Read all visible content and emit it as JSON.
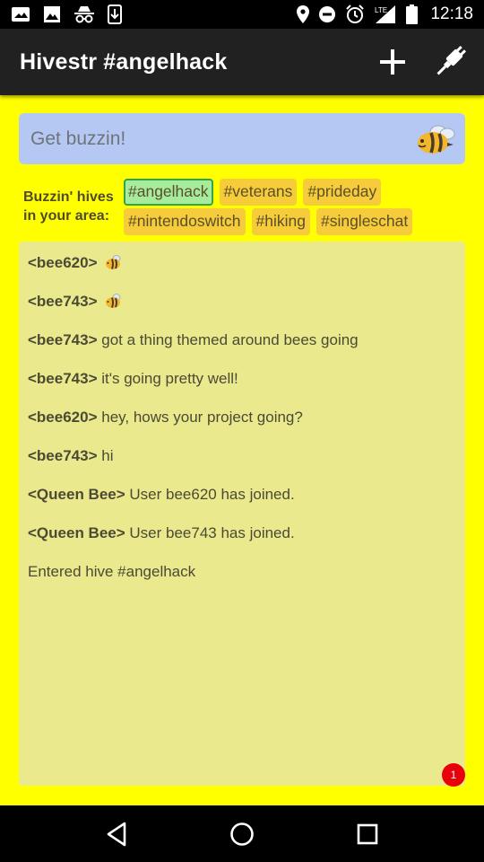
{
  "status_bar": {
    "time": "12:18",
    "icons": [
      "image-icon",
      "photo-icon",
      "incognito-icon",
      "download-icon",
      "location-icon",
      "do-not-disturb-icon",
      "alarm-icon",
      "lte-signal-icon",
      "battery-icon"
    ],
    "network_label": "LTE"
  },
  "app_bar": {
    "title": "Hivestr #angelhack",
    "actions": [
      "add-icon",
      "plug-icon"
    ]
  },
  "composer": {
    "placeholder": "Get buzzin!",
    "value": "",
    "icon": "bee-icon"
  },
  "hives": {
    "label_line1": "Buzzin' hives",
    "label_line2": "in your area:",
    "row1": [
      {
        "tag": "#angelhack",
        "active": true
      },
      {
        "tag": "#veterans",
        "active": false
      },
      {
        "tag": "#prideday",
        "active": false
      }
    ],
    "row2": [
      {
        "tag": "#nintendoswitch",
        "active": false
      },
      {
        "tag": "#hiking",
        "active": false
      },
      {
        "tag": "#singleschat",
        "active": false
      }
    ]
  },
  "messages": [
    {
      "user": "<bee620>",
      "text": "",
      "emoji": "bee-icon"
    },
    {
      "user": "<bee743>",
      "text": "",
      "emoji": "bee-icon"
    },
    {
      "user": "<bee743>",
      "text": " got a thing themed around bees going"
    },
    {
      "user": "<bee743>",
      "text": " it's going pretty well!"
    },
    {
      "user": "<bee620>",
      "text": " hey, hows your project going?"
    },
    {
      "user": "<bee743>",
      "text": " hi"
    },
    {
      "user": "<Queen Bee>",
      "text": " User bee620 has joined."
    },
    {
      "user": "<Queen Bee>",
      "text": " User bee743 has joined."
    },
    {
      "user": "",
      "text": "Entered hive #angelhack"
    }
  ],
  "unread_badge": "1",
  "nav_bar": [
    "back-icon",
    "home-icon",
    "recents-icon"
  ],
  "colors": {
    "background": "#ffff00",
    "app_bar": "#212121",
    "composer": "#b4c8f3",
    "hive_tag": "#f7cc3a",
    "hive_tag_active": "#a6ec9c",
    "chat_panel": "#eae98d",
    "badge": "#e8000b"
  }
}
